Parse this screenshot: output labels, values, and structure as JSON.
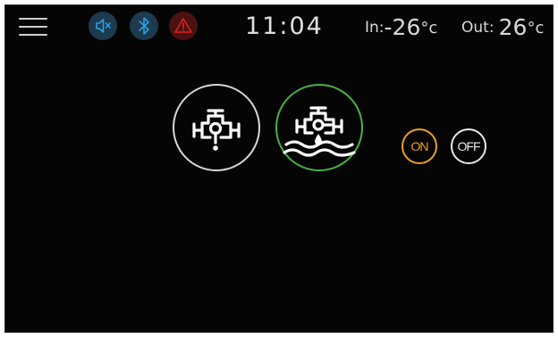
{
  "status_bar": {
    "clock": "11:04",
    "indoor": {
      "label": "In:",
      "value": "-26",
      "unit": "°c"
    },
    "outdoor": {
      "label": "Out:",
      "value": "26",
      "unit": "°c"
    },
    "icons": [
      "menu-icon",
      "speaker-mute-icon",
      "bluetooth-icon",
      "warning-icon"
    ],
    "colors": {
      "icon_blue_bg": "#1d3a4f",
      "icon_blue": "#2aa0e0",
      "warning_bg": "#4a1212",
      "warning": "#e02020"
    }
  },
  "controls": {
    "valves": [
      {
        "name": "drain-valve",
        "icon": "valve-drain-icon",
        "ring_color": "#d8d8d8"
      },
      {
        "name": "fill-valve",
        "icon": "valve-fill-icon",
        "ring_color": "#4ab04a"
      }
    ],
    "toggle_on_label": "ON",
    "toggle_off_label": "OFF",
    "toggle_on_color": "#e8a020",
    "toggle_off_color": "#e8e8e8"
  }
}
